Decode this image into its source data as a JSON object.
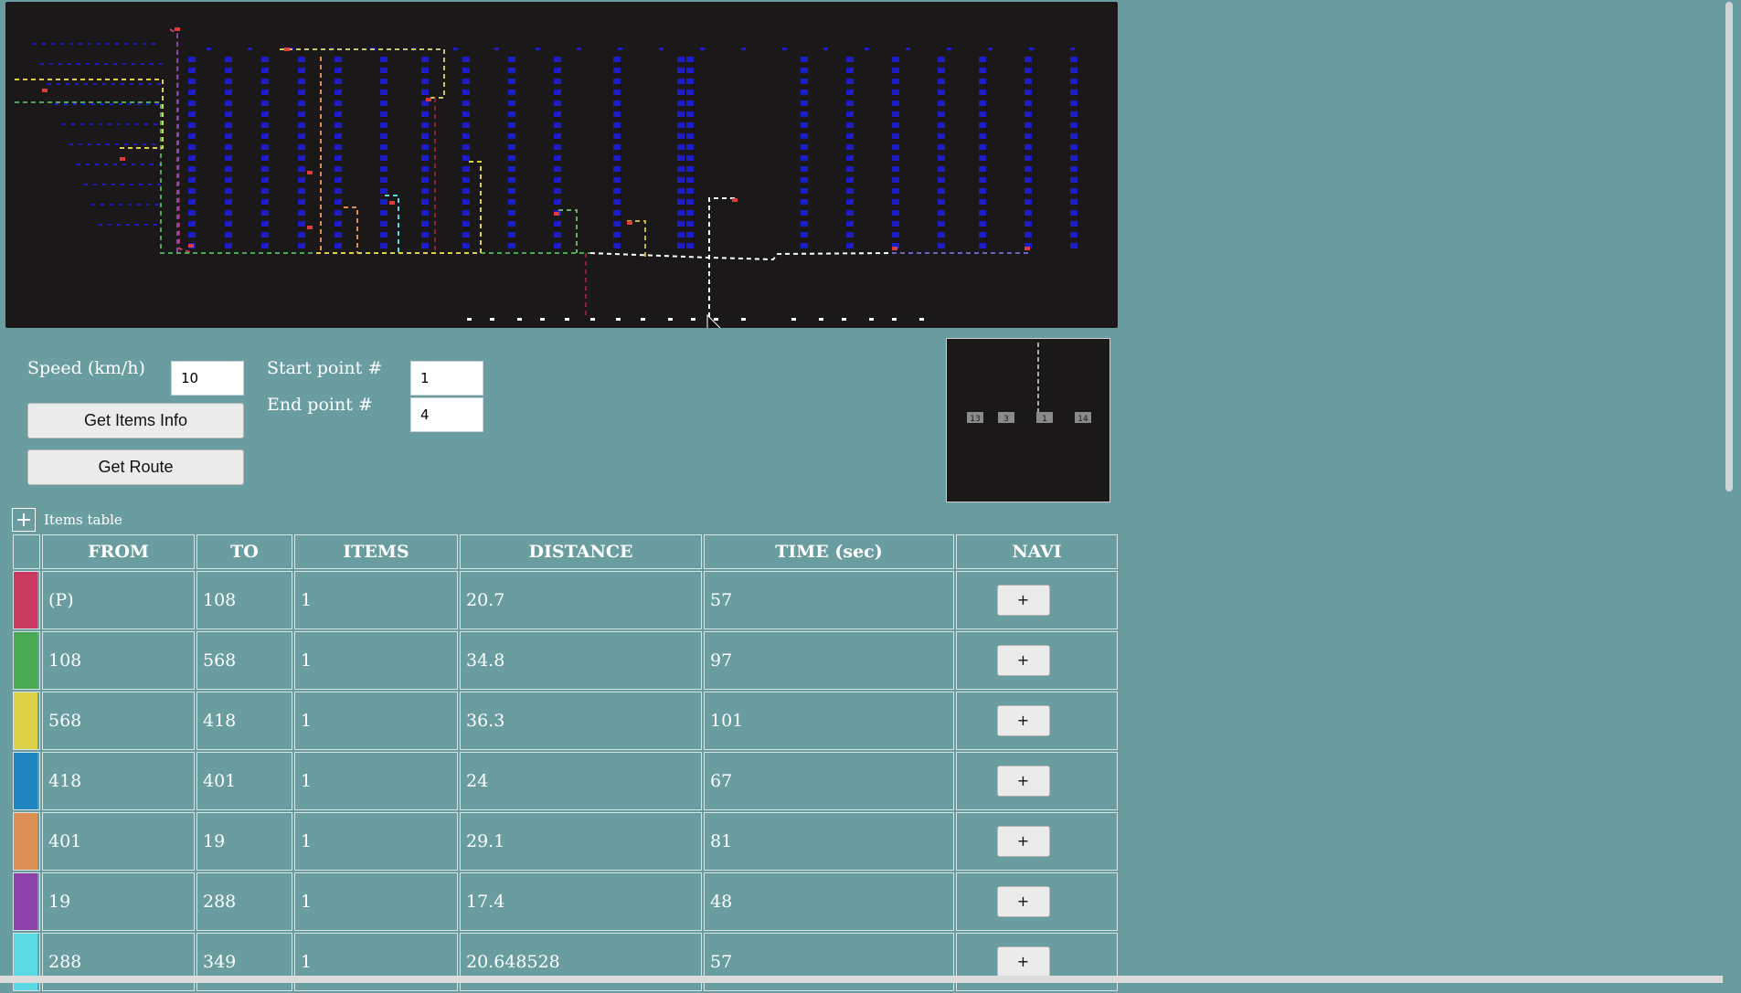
{
  "form": {
    "speed_label": "Speed (km/h)",
    "speed_value": "10",
    "start_label": "Start point #",
    "start_value": "1",
    "end_label": "End point #",
    "end_value": "4",
    "items_info_button": "Get Items Info",
    "route_button": "Get Route"
  },
  "minimap": {
    "labels": [
      "13",
      "3",
      "1",
      "14"
    ]
  },
  "items_table": {
    "title": "Items table",
    "toggle_icon": "plus-square-icon",
    "headers": [
      "FROM",
      "TO",
      "ITEMS",
      "DISTANCE",
      "TIME (sec)",
      "NAVI"
    ],
    "rows": [
      {
        "color": "#c93a60",
        "from": "(P)",
        "to": "108",
        "items": "1",
        "distance": "20.7",
        "time": "57",
        "navi": "+"
      },
      {
        "color": "#4aaa54",
        "from": "108",
        "to": "568",
        "items": "1",
        "distance": "34.8",
        "time": "97",
        "navi": "+"
      },
      {
        "color": "#ddd247",
        "from": "568",
        "to": "418",
        "items": "1",
        "distance": "36.3",
        "time": "101",
        "navi": "+"
      },
      {
        "color": "#1f86c2",
        "from": "418",
        "to": "401",
        "items": "1",
        "distance": "24",
        "time": "67",
        "navi": "+"
      },
      {
        "color": "#dd8f55",
        "from": "401",
        "to": "19",
        "items": "1",
        "distance": "29.1",
        "time": "81",
        "navi": "+"
      },
      {
        "color": "#8c42a8",
        "from": "19",
        "to": "288",
        "items": "1",
        "distance": "17.4",
        "time": "48",
        "navi": "+"
      },
      {
        "color": "#5ad9e2",
        "from": "288",
        "to": "349",
        "items": "1",
        "distance": "20.648528",
        "time": "57",
        "navi": "+"
      }
    ]
  }
}
